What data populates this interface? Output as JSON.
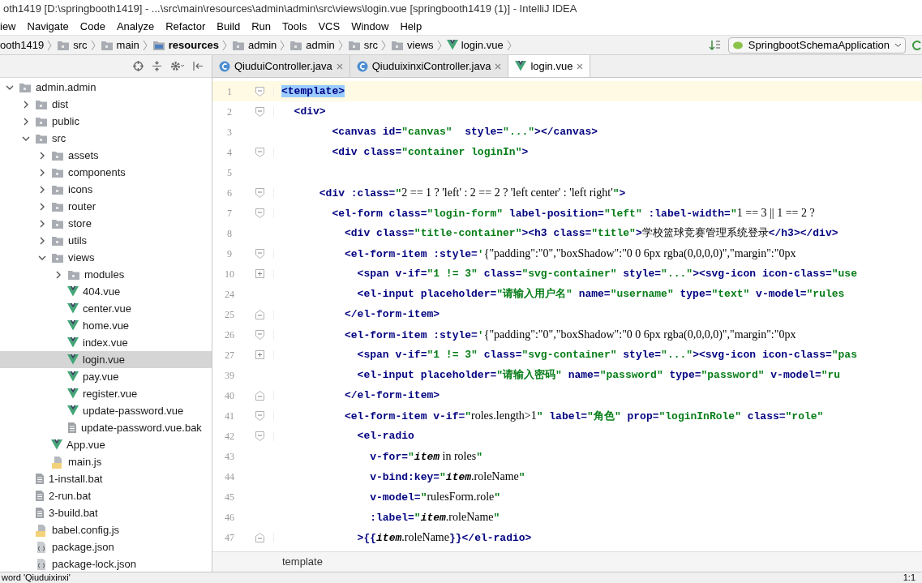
{
  "window": {
    "title": "oth1419 [D:\\springbooth1419] - ...\\src\\main\\resources\\admin\\admin\\src\\views\\login.vue [springbooth1419 (1)] - IntelliJ IDEA"
  },
  "menu": [
    "iew",
    "Navigate",
    "Code",
    "Analyze",
    "Refactor",
    "Build",
    "Run",
    "Tools",
    "VCS",
    "Window",
    "Help"
  ],
  "breadcrumbs": [
    {
      "label": "ooth1419",
      "kind": "project"
    },
    {
      "label": "src",
      "kind": "folder"
    },
    {
      "label": "main",
      "kind": "folder"
    },
    {
      "label": "resources",
      "kind": "resources"
    },
    {
      "label": "admin",
      "kind": "folder"
    },
    {
      "label": "admin",
      "kind": "folder"
    },
    {
      "label": "src",
      "kind": "folder"
    },
    {
      "label": "views",
      "kind": "folder"
    },
    {
      "label": "login.vue",
      "kind": "vue"
    }
  ],
  "run_config": "SpringbootSchemaApplication",
  "tabs": [
    {
      "label": "QiuduiController.java",
      "kind": "java",
      "selected": false
    },
    {
      "label": "QiuduixinxiController.java",
      "kind": "java",
      "selected": false
    },
    {
      "label": "login.vue",
      "kind": "vue",
      "selected": true
    }
  ],
  "tree": [
    {
      "label": "admin.admin",
      "kind": "folder",
      "expanded": true,
      "selected": false,
      "children": [
        {
          "label": "dist",
          "kind": "folder",
          "expanded": false,
          "selected": false
        },
        {
          "label": "public",
          "kind": "folder",
          "expanded": false,
          "selected": false
        },
        {
          "label": "src",
          "kind": "folder",
          "expanded": true,
          "selected": false,
          "children": [
            {
              "label": "assets",
              "kind": "folder",
              "expanded": false,
              "selected": false
            },
            {
              "label": "components",
              "kind": "folder",
              "expanded": false,
              "selected": false
            },
            {
              "label": "icons",
              "kind": "folder",
              "expanded": false,
              "selected": false
            },
            {
              "label": "router",
              "kind": "folder",
              "expanded": false,
              "selected": false
            },
            {
              "label": "store",
              "kind": "folder",
              "expanded": false,
              "selected": false
            },
            {
              "label": "utils",
              "kind": "folder",
              "expanded": false,
              "selected": false
            },
            {
              "label": "views",
              "kind": "folder",
              "expanded": true,
              "selected": false,
              "children": [
                {
                  "label": "modules",
                  "kind": "folder",
                  "expanded": false,
                  "selected": false
                },
                {
                  "label": "404.vue",
                  "kind": "vue",
                  "selected": false
                },
                {
                  "label": "center.vue",
                  "kind": "vue",
                  "selected": false
                },
                {
                  "label": "home.vue",
                  "kind": "vue",
                  "selected": false
                },
                {
                  "label": "index.vue",
                  "kind": "vue",
                  "selected": false
                },
                {
                  "label": "login.vue",
                  "kind": "vue",
                  "selected": true
                },
                {
                  "label": "pay.vue",
                  "kind": "vue",
                  "selected": false
                },
                {
                  "label": "register.vue",
                  "kind": "vue",
                  "selected": false
                },
                {
                  "label": "update-password.vue",
                  "kind": "vue",
                  "selected": false
                },
                {
                  "label": "update-password.vue.bak",
                  "kind": "file",
                  "selected": false
                }
              ]
            },
            {
              "label": "App.vue",
              "kind": "vue",
              "selected": false
            },
            {
              "label": "main.js",
              "kind": "js",
              "selected": false
            }
          ]
        },
        {
          "label": "1-install.bat",
          "kind": "file",
          "selected": false
        },
        {
          "label": "2-run.bat",
          "kind": "file",
          "selected": false
        },
        {
          "label": "3-build.bat",
          "kind": "file",
          "selected": false
        },
        {
          "label": "babel.config.js",
          "kind": "js",
          "selected": false
        },
        {
          "label": "package.json",
          "kind": "json",
          "selected": false
        },
        {
          "label": "package-lock.json",
          "kind": "json",
          "selected": false
        }
      ]
    }
  ],
  "code": [
    {
      "number": "1",
      "kind": "start",
      "current": true,
      "tokens": [
        {
          "kind": "match",
          "text": "<template>"
        }
      ]
    },
    {
      "number": "2",
      "kind": "start",
      "current": false,
      "tokens": [
        {
          "kind": "tag",
          "text": "  <div>"
        }
      ]
    },
    {
      "number": "3",
      "kind": "none",
      "current": false,
      "tokens": [
        {
          "kind": "tag",
          "text": "        <canvas id="
        },
        {
          "kind": "str",
          "text": "\"canvas\""
        },
        {
          "kind": "tag",
          "text": "  style="
        },
        {
          "kind": "str",
          "text": "\"...\""
        },
        {
          "kind": "tag",
          "text": "></canvas>"
        }
      ]
    },
    {
      "number": "4",
      "kind": "start",
      "current": false,
      "tokens": [
        {
          "kind": "tag",
          "text": "        <div class="
        },
        {
          "kind": "str",
          "text": "\"container loginIn\""
        },
        {
          "kind": "tag",
          "text": ">"
        }
      ]
    },
    {
      "number": "5",
      "kind": "none",
      "current": false
    },
    {
      "number": "6",
      "kind": "start",
      "current": false,
      "tokens": [
        {
          "kind": "tag",
          "text": "      <div :class="
        },
        {
          "kind": "str",
          "text": "\""
        },
        {
          "kind": "js",
          "text": "2 == 1 ? 'left' : 2 == 2 ? 'left center' : 'left right'"
        },
        {
          "kind": "str",
          "text": "\""
        },
        {
          "kind": "tag",
          "text": ">"
        }
      ]
    },
    {
      "number": "7",
      "kind": "start",
      "current": false,
      "tokens": [
        {
          "kind": "tag",
          "text": "        <el-form class="
        },
        {
          "kind": "str",
          "text": "\"login-form\""
        },
        {
          "kind": "tag",
          "text": " label-position="
        },
        {
          "kind": "str",
          "text": "\"left\""
        },
        {
          "kind": "tag",
          "text": " :label-width="
        },
        {
          "kind": "str",
          "text": "\""
        },
        {
          "kind": "js",
          "text": "1 == 3 || 1 == 2 ?"
        }
      ]
    },
    {
      "number": "8",
      "kind": "none",
      "current": false,
      "tokens": [
        {
          "kind": "tag",
          "text": "          <div class="
        },
        {
          "kind": "str",
          "text": "\"title-container\""
        },
        {
          "kind": "tag",
          "text": "><h3 class="
        },
        {
          "kind": "str",
          "text": "\"title\""
        },
        {
          "kind": "tag",
          "text": ">"
        },
        {
          "kind": "plain",
          "text": "学校篮球竞赛管理系统登录"
        },
        {
          "kind": "tag",
          "text": "</h3></div>"
        }
      ]
    },
    {
      "number": "9",
      "kind": "start",
      "current": false,
      "tokens": [
        {
          "kind": "tag",
          "text": "          <el-form-item :style="
        },
        {
          "kind": "str",
          "text": "'"
        },
        {
          "kind": "js",
          "text": "{\"padding\":\"0\",\"boxShadow\":\"0 0 6px rgba(0,0,0,0)\",\"margin\":\"0px"
        }
      ]
    },
    {
      "number": "10",
      "kind": "collapsed",
      "current": false,
      "tokens": [
        {
          "kind": "tag",
          "text": "            <span v-if="
        },
        {
          "kind": "str",
          "text": "\"1 != 3\""
        },
        {
          "kind": "tag",
          "text": " class="
        },
        {
          "kind": "str",
          "text": "\"svg-container\""
        },
        {
          "kind": "tag",
          "text": " style="
        },
        {
          "kind": "str",
          "text": "\"...\""
        },
        {
          "kind": "tag",
          "text": "><svg-icon icon-class="
        },
        {
          "kind": "str",
          "text": "\"use"
        }
      ]
    },
    {
      "number": "24",
      "kind": "none",
      "current": false,
      "tokens": [
        {
          "kind": "tag",
          "text": "            <el-input placeholder="
        },
        {
          "kind": "str",
          "text": "\"请输入用户名\""
        },
        {
          "kind": "tag",
          "text": " name="
        },
        {
          "kind": "str",
          "text": "\"username\""
        },
        {
          "kind": "tag",
          "text": " type="
        },
        {
          "kind": "str",
          "text": "\"text\""
        },
        {
          "kind": "tag",
          "text": " v-model="
        },
        {
          "kind": "str",
          "text": "\"rules"
        }
      ]
    },
    {
      "number": "25",
      "kind": "end",
      "current": false,
      "tokens": [
        {
          "kind": "tag",
          "text": "          </el-form-item>"
        }
      ]
    },
    {
      "number": "26",
      "kind": "start",
      "current": false,
      "tokens": [
        {
          "kind": "tag",
          "text": "          <el-form-item :style="
        },
        {
          "kind": "str",
          "text": "'"
        },
        {
          "kind": "js",
          "text": "{\"padding\":\"0\",\"boxShadow\":\"0 0 6px rgba(0,0,0,0)\",\"margin\":\"0px"
        }
      ]
    },
    {
      "number": "27",
      "kind": "collapsed",
      "current": false,
      "tokens": [
        {
          "kind": "tag",
          "text": "            <span v-if="
        },
        {
          "kind": "str",
          "text": "\"1 != 3\""
        },
        {
          "kind": "tag",
          "text": " class="
        },
        {
          "kind": "str",
          "text": "\"svg-container\""
        },
        {
          "kind": "tag",
          "text": " style="
        },
        {
          "kind": "str",
          "text": "\"...\""
        },
        {
          "kind": "tag",
          "text": "><svg-icon icon-class="
        },
        {
          "kind": "str",
          "text": "\"pas"
        }
      ]
    },
    {
      "number": "39",
      "kind": "none",
      "current": false,
      "tokens": [
        {
          "kind": "tag",
          "text": "            <el-input placeholder="
        },
        {
          "kind": "str",
          "text": "\"请输入密码\""
        },
        {
          "kind": "tag",
          "text": " name="
        },
        {
          "kind": "str",
          "text": "\"password\""
        },
        {
          "kind": "tag",
          "text": " type="
        },
        {
          "kind": "str",
          "text": "\"password\""
        },
        {
          "kind": "tag",
          "text": " v-model="
        },
        {
          "kind": "str",
          "text": "\"ru"
        }
      ]
    },
    {
      "number": "40",
      "kind": "end",
      "current": false,
      "tokens": [
        {
          "kind": "tag",
          "text": "          </el-form-item>"
        }
      ]
    },
    {
      "number": "41",
      "kind": "start",
      "current": false,
      "tokens": [
        {
          "kind": "tag",
          "text": "          <el-form-item v-if="
        },
        {
          "kind": "str",
          "text": "\""
        },
        {
          "kind": "js",
          "text": "roles.length>1"
        },
        {
          "kind": "str",
          "text": "\""
        },
        {
          "kind": "tag",
          "text": " label="
        },
        {
          "kind": "str",
          "text": "\"角色\""
        },
        {
          "kind": "tag",
          "text": " prop="
        },
        {
          "kind": "str",
          "text": "\"loginInRole\""
        },
        {
          "kind": "tag",
          "text": " class="
        },
        {
          "kind": "str",
          "text": "\"role\""
        }
      ]
    },
    {
      "number": "42",
      "kind": "start",
      "current": false,
      "tokens": [
        {
          "kind": "tag",
          "text": "            <el-radio"
        }
      ]
    },
    {
      "number": "43",
      "kind": "none",
      "current": false,
      "tokens": [
        {
          "kind": "tag",
          "text": "              v-for="
        },
        {
          "kind": "str",
          "text": "\""
        },
        {
          "kind": "ital",
          "text": "item"
        },
        {
          "kind": "js",
          "text": " in roles"
        },
        {
          "kind": "str",
          "text": "\""
        }
      ]
    },
    {
      "number": "44",
      "kind": "none",
      "current": false,
      "tokens": [
        {
          "kind": "tag",
          "text": "              v-bind:key="
        },
        {
          "kind": "str",
          "text": "\""
        },
        {
          "kind": "ital",
          "text": "item"
        },
        {
          "kind": "js",
          "text": ".roleName"
        },
        {
          "kind": "str",
          "text": "\""
        }
      ]
    },
    {
      "number": "45",
      "kind": "none",
      "current": false,
      "tokens": [
        {
          "kind": "tag",
          "text": "              v-model="
        },
        {
          "kind": "str",
          "text": "\""
        },
        {
          "kind": "js",
          "text": "rulesForm.role"
        },
        {
          "kind": "str",
          "text": "\""
        }
      ]
    },
    {
      "number": "46",
      "kind": "none",
      "current": false,
      "tokens": [
        {
          "kind": "tag",
          "text": "              :label="
        },
        {
          "kind": "str",
          "text": "\""
        },
        {
          "kind": "ital",
          "text": "item"
        },
        {
          "kind": "js",
          "text": ".roleName"
        },
        {
          "kind": "str",
          "text": "\""
        }
      ]
    },
    {
      "number": "47",
      "kind": "end",
      "current": false,
      "tokens": [
        {
          "kind": "tag",
          "text": "            >{{"
        },
        {
          "kind": "ital",
          "text": "item"
        },
        {
          "kind": "js",
          "text": ".roleName"
        },
        {
          "kind": "tag",
          "text": "}}</el-radio>"
        }
      ]
    }
  ],
  "editor_breadcrumb": "template",
  "status_bar": {
    "message": "word 'Qiuduixinxi'",
    "position": "1:1"
  }
}
